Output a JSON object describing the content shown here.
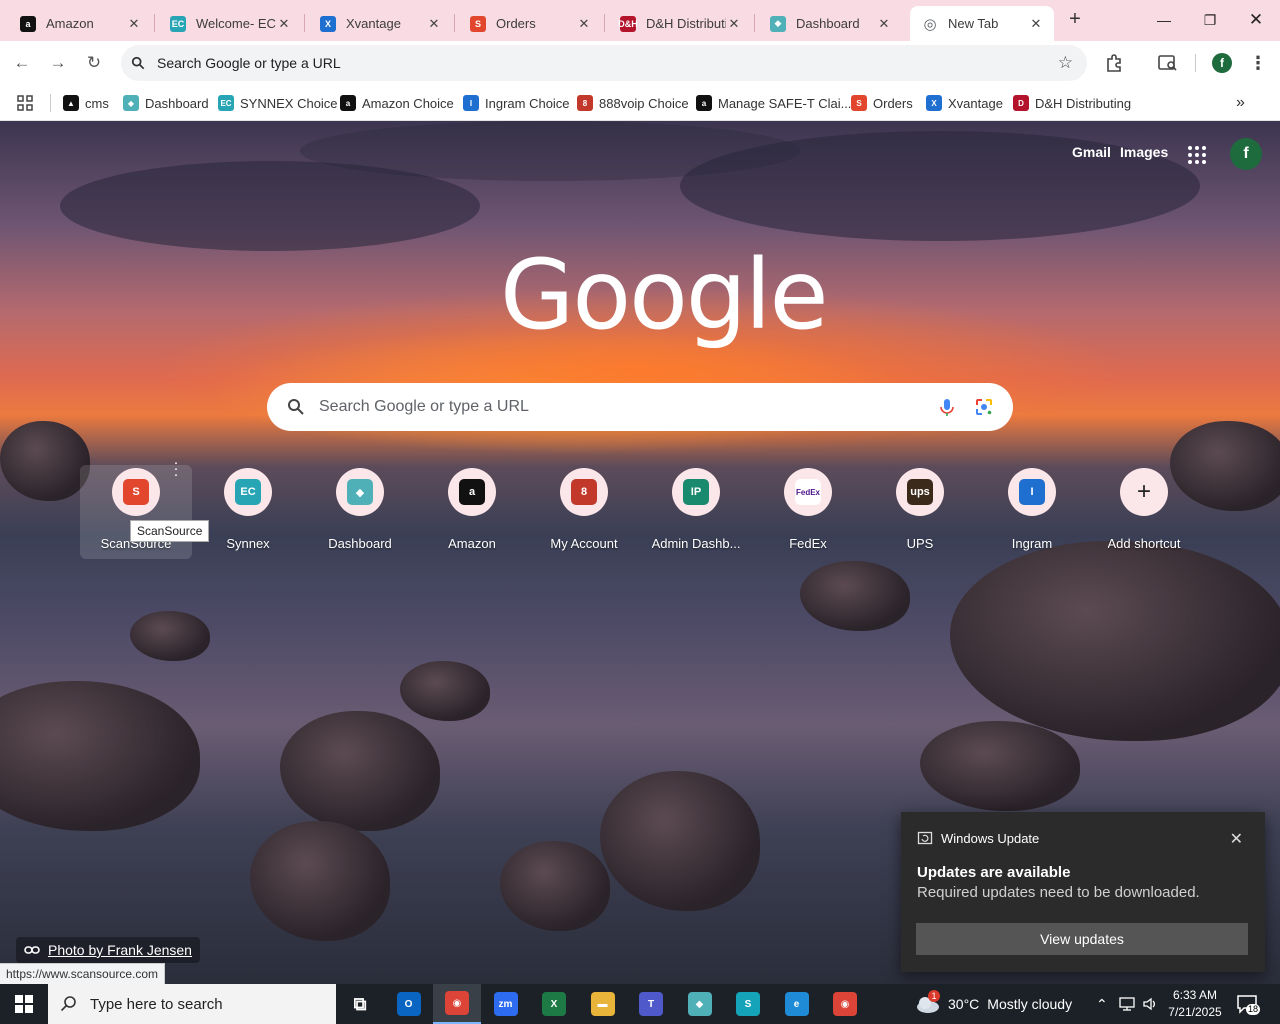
{
  "tabs": [
    {
      "title": "Amazon",
      "favicon": "amazon-icon",
      "color": "#111111",
      "glyph": "a"
    },
    {
      "title": "Welcome- ECE",
      "favicon": "ec-icon",
      "color": "#27a5b5",
      "glyph": "EC"
    },
    {
      "title": "Xvantage",
      "favicon": "xvantage-icon",
      "color": "#1f6fd1",
      "glyph": "X"
    },
    {
      "title": "Orders",
      "favicon": "orders-icon",
      "color": "#e2472d",
      "glyph": "S"
    },
    {
      "title": "D&H Distributi",
      "favicon": "dh-icon",
      "color": "#b3142b",
      "glyph": "D&H"
    },
    {
      "title": "Dashboard",
      "favicon": "dashboard-icon",
      "color": "#4fb0b8",
      "glyph": "◆"
    },
    {
      "title": "New Tab",
      "favicon": "chrome-icon",
      "color": "#5f6368",
      "glyph": "◎"
    }
  ],
  "omnibox": {
    "placeholder": "Search Google or type a URL"
  },
  "bookmarks": [
    {
      "label": "cms",
      "color": "#111111",
      "glyph": "▲"
    },
    {
      "label": "Dashboard",
      "color": "#4fb0b8",
      "glyph": "◆"
    },
    {
      "label": "SYNNEX Choice",
      "color": "#27a5b5",
      "glyph": "EC"
    },
    {
      "label": "Amazon Choice",
      "color": "#111111",
      "glyph": "a"
    },
    {
      "label": "Ingram Choice",
      "color": "#1f6fd1",
      "glyph": "I"
    },
    {
      "label": "888voip Choice",
      "color": "#c2392c",
      "glyph": "8"
    },
    {
      "label": "Manage SAFE-T Clai...",
      "color": "#111111",
      "glyph": "a"
    },
    {
      "label": "Orders",
      "color": "#e2472d",
      "glyph": "S"
    },
    {
      "label": "Xvantage",
      "color": "#1f6fd1",
      "glyph": "X"
    },
    {
      "label": "D&H Distributing",
      "color": "#b3142b",
      "glyph": "D"
    }
  ],
  "ntp": {
    "gmail": "Gmail",
    "images": "Images",
    "avatar_letter": "f",
    "logo": "Google",
    "search_placeholder": "Search Google or type a URL",
    "tooltip": "ScanSource",
    "photo_credit": "Photo by Frank Jensen",
    "status_url": "https://www.scansource.com"
  },
  "shortcuts": [
    {
      "label": "ScanSource",
      "color": "#e2472d",
      "glyph": "S"
    },
    {
      "label": "Synnex",
      "color": "#27a5b5",
      "glyph": "EC"
    },
    {
      "label": "Dashboard",
      "color": "#4fb0b8",
      "glyph": "◆"
    },
    {
      "label": "Amazon",
      "color": "#111111",
      "glyph": "a"
    },
    {
      "label": "My Account",
      "color": "#c2392c",
      "glyph": "8"
    },
    {
      "label": "Admin Dashb...",
      "color": "#1a8a6e",
      "glyph": "IP"
    },
    {
      "label": "FedEx",
      "color": "#4d148c",
      "glyph": "FedEx"
    },
    {
      "label": "UPS",
      "color": "#3b2a1a",
      "glyph": "ups"
    },
    {
      "label": "Ingram",
      "color": "#1f6fd1",
      "glyph": "I"
    },
    {
      "label": "Add shortcut",
      "color": "#fbe6ea",
      "glyph": "+"
    }
  ],
  "toast": {
    "app": "Windows Update",
    "title": "Updates are available",
    "body": "Required updates need to be downloaded.",
    "button": "View updates"
  },
  "taskbar": {
    "search_placeholder": "Type here to search",
    "apps": [
      {
        "name": "task-view-icon",
        "color": "#1c2127",
        "glyph": "⧉"
      },
      {
        "name": "outlook-icon",
        "color": "#0a64c2",
        "glyph": "O"
      },
      {
        "name": "chrome-icon",
        "color": "#db4437",
        "glyph": "◉"
      },
      {
        "name": "zoom-icon",
        "color": "#2d6cf0",
        "glyph": "zm"
      },
      {
        "name": "excel-icon",
        "color": "#1d7a45",
        "glyph": "X"
      },
      {
        "name": "file-explorer-icon",
        "color": "#e8b43a",
        "glyph": "▬"
      },
      {
        "name": "teams-icon",
        "color": "#5059c9",
        "glyph": "T"
      },
      {
        "name": "dashboard-app-icon",
        "color": "#4fb0b8",
        "glyph": "◆"
      },
      {
        "name": "app-s-icon",
        "color": "#14a3b8",
        "glyph": "S"
      },
      {
        "name": "edge-icon",
        "color": "#1f8ad6",
        "glyph": "e"
      },
      {
        "name": "chrome-profile-icon",
        "color": "#db4437",
        "glyph": "◉"
      }
    ],
    "weather_temp": "30°C",
    "weather_text": "Mostly cloudy",
    "weather_badge": "1",
    "time": "6:33 AM",
    "date": "7/21/2025",
    "notification_count": "18"
  }
}
